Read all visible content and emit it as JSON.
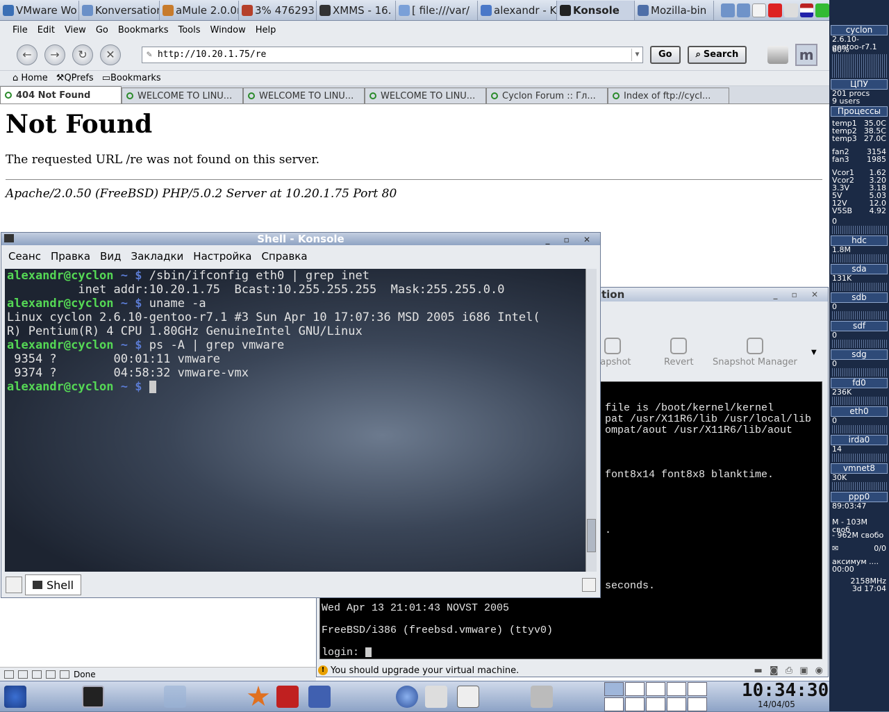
{
  "taskbar": {
    "tasks": [
      "VMware Wo",
      "Konversation",
      "aMule 2.0.0r",
      "3% 476293",
      "XMMS - 16.",
      "[ file:///var/",
      "alexandr - K",
      "Konsole",
      "Mozilla-bin"
    ]
  },
  "browser": {
    "menu": [
      "File",
      "Edit",
      "View",
      "Go",
      "Bookmarks",
      "Tools",
      "Window",
      "Help"
    ],
    "url": "http://10.20.1.75/re",
    "go_label": "Go",
    "search_label": "Search",
    "bookmarks": [
      "Home",
      "QPrefs",
      "Bookmarks"
    ],
    "tabs": [
      "404 Not Found",
      "WELCOME TO LINU...",
      "WELCOME TO LINU...",
      "WELCOME TO LINU...",
      "Cyclon Forum :: Гл...",
      "Index of ftp://cycl..."
    ],
    "page": {
      "heading": "Not Found",
      "message": "The requested URL /re was not found on this server.",
      "address": "Apache/2.0.50 (FreeBSD) PHP/5.0.2 Server at 10.20.1.75 Port 80"
    },
    "status": "Done"
  },
  "konsole": {
    "title": "Shell - Konsole",
    "menu": [
      "Сеанс",
      "Правка",
      "Вид",
      "Закладки",
      "Настройка",
      "Справка"
    ],
    "prompt_user": "alexandr@cyclon",
    "prompt_dir": "~ $",
    "cmd1": "/sbin/ifconfig eth0 | grep inet",
    "out1": "          inet addr:10.20.1.75  Bcast:10.255.255.255  Mask:255.255.0.0",
    "cmd2": "uname -a",
    "out2a": "Linux cyclon 2.6.10-gentoo-r7.1 #3 Sun Apr 10 17:07:36 MSD 2005 i686 Intel(",
    "out2b": "R) Pentium(R) 4 CPU 1.80GHz GenuineIntel GNU/Linux",
    "cmd3": "ps -A | grep vmware",
    "out3a": " 9354 ?        00:01:11 vmware",
    "out3b": " 9374 ?        04:58:32 vmware-vmx",
    "tab": "Shell"
  },
  "vmware": {
    "title_partial": "tion",
    "tools": [
      "napshot",
      "Revert",
      "Snapshot Manager"
    ],
    "console": [
      "file is /boot/kernel/kernel",
      "pat /usr/X11R6/lib /usr/local/lib",
      "ompat/aout /usr/X11R6/lib/aout",
      "font8x14 font8x8 blanktime.",
      ".",
      "seconds.",
      "Wed Apr 13 21:01:43 NOVST 2005",
      "FreeBSD/i386 (freebsd.vmware) (ttyv0)",
      "login: "
    ],
    "status": "You should upgrade your virtual machine."
  },
  "sidepanel": {
    "host": "cyclon",
    "kernel": "2.6.10-gentoo-r7.1",
    "cpu_pct": "60%",
    "cpu_label": "ЦПУ",
    "procs": "201 procs",
    "users": "9 users",
    "proc_label": "Процессы",
    "temps": [
      [
        "temp1",
        "35.0C"
      ],
      [
        "temp2",
        "38.5C"
      ],
      [
        "temp3",
        "27.0C"
      ]
    ],
    "fans": [
      [
        "fan2",
        "3154"
      ],
      [
        "fan3",
        "1985"
      ]
    ],
    "volts": [
      [
        "Vcor1",
        "1.62"
      ],
      [
        "Vcor2",
        "3.20"
      ],
      [
        "3.3V",
        "3.18"
      ],
      [
        "5V",
        "5.03"
      ],
      [
        "12V",
        "12.0"
      ],
      [
        "V5SB",
        "4.92"
      ]
    ],
    "zero": "0",
    "disks": [
      [
        "hdc",
        "1.8M"
      ],
      [
        "sda",
        "131K"
      ],
      [
        "sdb",
        "0"
      ],
      [
        "sdf",
        "0"
      ],
      [
        "sdg",
        "0"
      ],
      [
        "fd0",
        "236K"
      ],
      [
        "eth0",
        "0"
      ],
      [
        "irda0",
        "14"
      ],
      [
        "vmnet8",
        "30K"
      ],
      [
        "ppp0",
        "89:03:47"
      ]
    ],
    "mem1": "М - 103М своб",
    "mem2": "- 962М свобо",
    "mail": "0/0",
    "music": "аксимум ....",
    "time": "00:00",
    "freq": "2158MHz",
    "uptime": "3d 17:04"
  },
  "clock": {
    "time": "10:34:30",
    "date": "14/04/05"
  },
  "colors": {
    "prompt": "#55d855",
    "dir": "#5a7ad0",
    "accent": "#2e4a78"
  }
}
